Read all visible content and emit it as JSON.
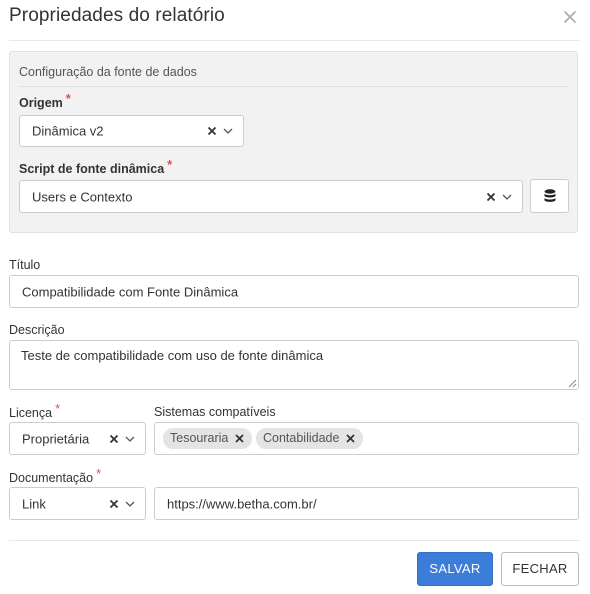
{
  "dialog": {
    "title": "Propriedades do relatório"
  },
  "data_source": {
    "section_title": "Configuração da fonte de dados",
    "origin": {
      "label": "Origem",
      "required_mark": "*",
      "value": "Dinâmica v2"
    },
    "script": {
      "label": "Script de fonte dinâmica",
      "required_mark": "*",
      "value": "Users e Contexto"
    }
  },
  "title_field": {
    "label": "Título",
    "value": "Compatibilidade com Fonte Dinâmica"
  },
  "description_field": {
    "label": "Descrição",
    "value": "Teste de compatibilidade com uso de fonte dinâmica"
  },
  "license_field": {
    "label": "Licença",
    "required_mark": "*",
    "value": "Proprietária"
  },
  "systems_field": {
    "label": "Sistemas compatíveis",
    "tags": [
      "Tesouraria",
      "Contabilidade"
    ]
  },
  "documentation_field": {
    "label": "Documentação",
    "required_mark": "*",
    "type": "Link",
    "url": "https://www.betha.com.br/"
  },
  "footer": {
    "save_label": "SALVAR",
    "close_label": "FECHAR"
  },
  "colors": {
    "primary": "#3b7dd8",
    "required": "#d9534f",
    "group_bg": "#f2f2f2"
  }
}
